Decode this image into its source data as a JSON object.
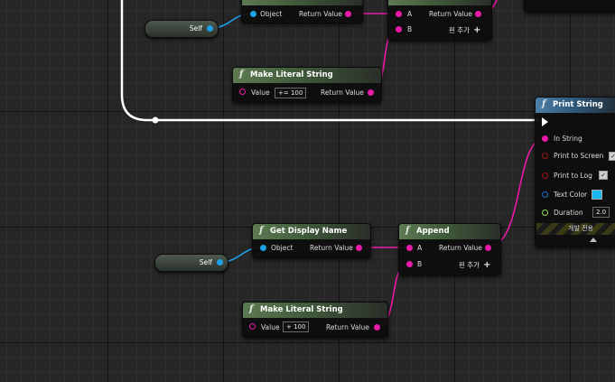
{
  "colors": {
    "object_pin": "#1ba1e6",
    "string_pin": "#ea1aa8",
    "exec_wire": "#ffffff",
    "bool_pin": "#a01616",
    "float_pin": "#8cd94b",
    "function_header": "#5d7a52",
    "print_header": "#4c7fa8",
    "text_color_swatch": "#1bb8f0"
  },
  "top": {
    "self": {
      "label": "Self"
    },
    "display_name": {
      "object": "Object",
      "return": "Return Value"
    },
    "append": {
      "a": "A",
      "b": "B",
      "return": "Return Value",
      "add_pin": "핀 추가"
    },
    "literal": {
      "title": "Make Literal String",
      "value_label": "Value",
      "value": "+= 100",
      "return": "Return Value"
    }
  },
  "print": {
    "title": "Print String",
    "in_string": "In String",
    "print_to_screen": "Print to Screen",
    "print_to_screen_checked": true,
    "print_to_log": "Print to Log",
    "print_to_log_checked": true,
    "text_color": "Text Color",
    "duration": "Duration",
    "duration_value": "2.0",
    "advanced_label": "개발 전용"
  },
  "bottom": {
    "self": {
      "label": "Self"
    },
    "display_name": {
      "title": "Get Display Name",
      "object": "Object",
      "return": "Return Value"
    },
    "append": {
      "title": "Append",
      "a": "A",
      "b": "B",
      "return": "Return Value",
      "add_pin": "핀 추가"
    },
    "literal": {
      "title": "Make Literal String",
      "value_label": "Value",
      "value": "+ 100",
      "return": "Return Value"
    }
  }
}
